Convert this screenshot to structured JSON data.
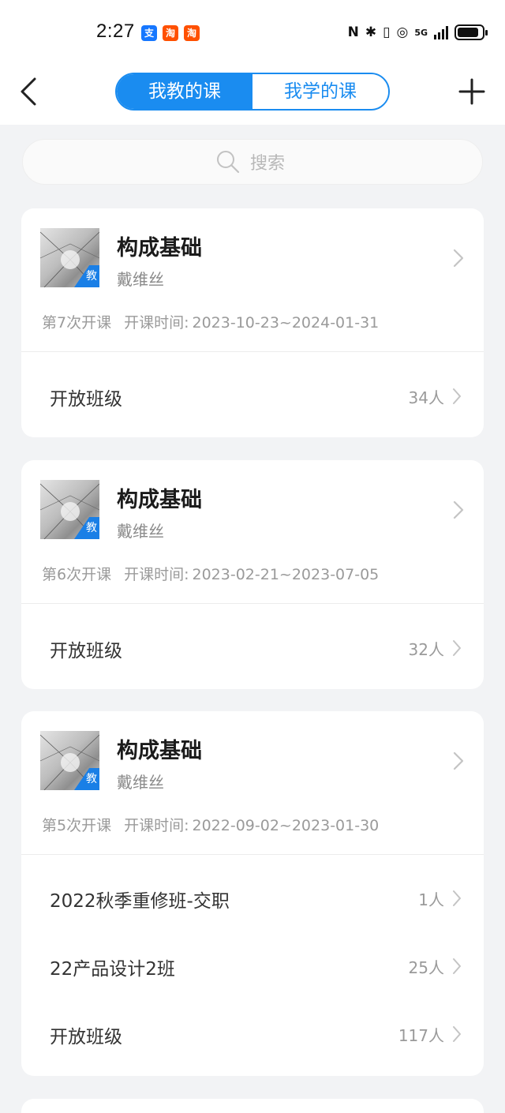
{
  "status_bar": {
    "time": "2:27",
    "apps": [
      {
        "glyph": "支",
        "color": "#1677ff"
      },
      {
        "glyph": "淘",
        "color": "#ff5000"
      },
      {
        "glyph": "淘",
        "color": "#ff5000"
      }
    ],
    "network": "5G"
  },
  "nav": {
    "tab_teach": "我教的课",
    "tab_learn": "我学的课"
  },
  "search": {
    "placeholder": "搜索"
  },
  "courses": [
    {
      "title": "构成基础",
      "teacher": "戴维丝",
      "cover_badge": "教",
      "session": "第7次开课",
      "time_label": "开课时间:",
      "time_range": "2023-10-23~2024-01-31",
      "classes": [
        {
          "name": "开放班级",
          "count": "34人"
        }
      ]
    },
    {
      "title": "构成基础",
      "teacher": "戴维丝",
      "cover_badge": "教",
      "session": "第6次开课",
      "time_label": "开课时间:",
      "time_range": "2023-02-21~2023-07-05",
      "classes": [
        {
          "name": "开放班级",
          "count": "32人"
        }
      ]
    },
    {
      "title": "构成基础",
      "teacher": "戴维丝",
      "cover_badge": "教",
      "session": "第5次开课",
      "time_label": "开课时间:",
      "time_range": "2022-09-02~2023-01-30",
      "classes": [
        {
          "name": "2022秋季重修班-交职",
          "count": "1人"
        },
        {
          "name": "22产品设计2班",
          "count": "25人"
        },
        {
          "name": "开放班级",
          "count": "117人"
        }
      ]
    }
  ],
  "colors": {
    "accent": "#1a8cf0",
    "background": "#f2f3f5",
    "card": "#ffffff",
    "muted_text": "#9a9a9a"
  }
}
